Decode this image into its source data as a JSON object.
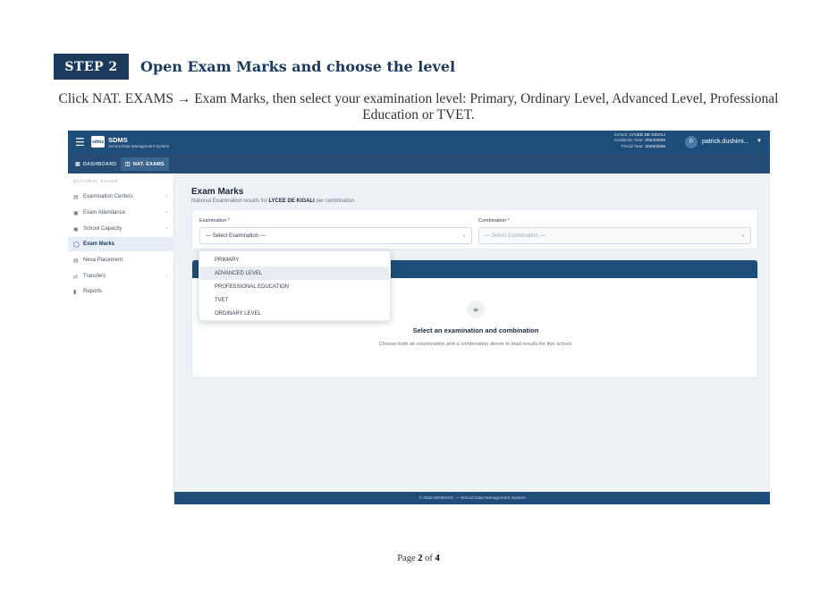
{
  "doc": {
    "step_label": "STEP 2",
    "step_title": "Open Exam Marks and choose the level",
    "step_desc": "Click NAT. EXAMS → Exam Marks, then select your examination level: Primary, Ordinary Level, Advanced Level, Professional Education or TVET.",
    "page_prefix": "Page",
    "page_current": "2",
    "page_of": "of",
    "page_total": "4"
  },
  "app": {
    "logo_text": "sdms",
    "name": "SDMS",
    "subtitle": "School Data Management System",
    "school_label": "School:",
    "school_name": "LYCEE DE KIGALI",
    "academic_label": "Academic Year:",
    "academic_year": "2024/2025",
    "fiscal_label": "Fiscal Year:",
    "fiscal_year": "2025/2026",
    "user_initial": "P",
    "user_name": "patrick.dushimi...",
    "nav_tabs": [
      {
        "label": "DASHBOARD",
        "active": false
      },
      {
        "label": "NAT. EXAMS",
        "active": true
      }
    ],
    "sidebar": {
      "heading": "NATIONAL EXAMS",
      "items": [
        {
          "label": "Examination Centers",
          "icon": "building-icon",
          "has_chevron": true,
          "active": false
        },
        {
          "label": "Exam Attendance",
          "icon": "calendar-icon",
          "has_chevron": true,
          "active": false
        },
        {
          "label": "School Capacity",
          "icon": "calendar-icon",
          "has_chevron": true,
          "active": false
        },
        {
          "label": "Exam Marks",
          "icon": "award-icon",
          "has_chevron": false,
          "active": true
        },
        {
          "label": "Nesa Placement",
          "icon": "id-card-icon",
          "has_chevron": false,
          "active": false
        },
        {
          "label": "Transfers",
          "icon": "transfer-icon",
          "has_chevron": true,
          "active": false
        },
        {
          "label": "Reports",
          "icon": "bar-chart-icon",
          "has_chevron": false,
          "active": false
        }
      ]
    },
    "main": {
      "title": "Exam Marks",
      "subtitle_prefix": "National Examination results for",
      "subtitle_school": "LYCEE DE KIGALI",
      "subtitle_suffix": "per combination.",
      "examination_label": "Examination",
      "examination_placeholder": "— Select Examination —",
      "combination_label": "Combination",
      "combination_placeholder": "— Select Combination —",
      "required_mark": "*",
      "dropdown_options": [
        "PRIMARY",
        "ADVANCED LEVEL",
        "PROFESSIONAL EDUCATION",
        "TVET",
        "ORDINARY LEVEL"
      ],
      "hovered_option": "ADVANCED LEVEL",
      "empty_title": "Select an examination and combination",
      "empty_desc": "Choose both an examination and a combination above to load results for this school."
    },
    "footer": "© 2026 MINEDUC — School Data Management System"
  },
  "colors": {
    "navy": "#1b3a5c",
    "primary": "#1f4d7a",
    "background": "#eef2f7",
    "required": "#dc2626"
  }
}
